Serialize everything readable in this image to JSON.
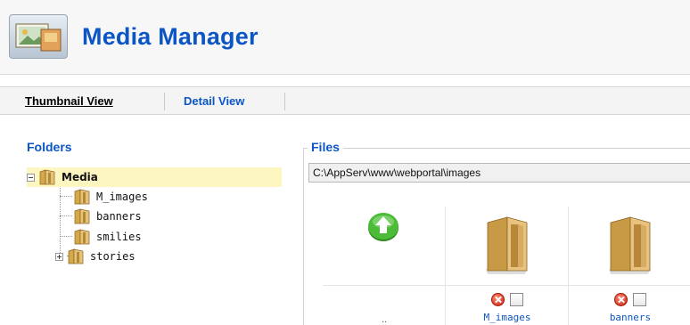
{
  "header": {
    "title": "Media Manager",
    "icon": "media-manager-icon"
  },
  "tabs": [
    {
      "label": "Thumbnail View",
      "active": true
    },
    {
      "label": "Detail View",
      "active": false
    }
  ],
  "folders": {
    "title": "Folders",
    "root": "Media",
    "items": [
      "M_images",
      "banners",
      "smilies",
      "stories"
    ]
  },
  "files": {
    "title": "Files",
    "path": "C:\\AppServ\\www\\webportal\\images",
    "up_label": "..",
    "items": [
      {
        "name": "M_images",
        "icon": "folder-icon"
      },
      {
        "name": "banners",
        "icon": "folder-icon"
      }
    ]
  },
  "colors": {
    "accent": "#0b55c4",
    "selected_bg": "#fdf6c0",
    "up_arrow": "#3aaa2a"
  }
}
